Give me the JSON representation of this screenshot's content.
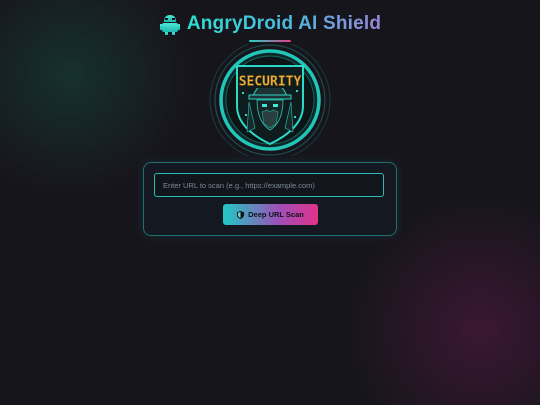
{
  "header": {
    "title": "AngryDroid AI Shield",
    "logo_icon": "droid-icon"
  },
  "badge": {
    "label": "SECURITY",
    "icon": "hooded-hacker-icon"
  },
  "scan": {
    "placeholder": "Enter URL to scan (e.g., https://example.com)",
    "value": "",
    "button_label": "Deep URL Scan",
    "button_icon": "shield-icon"
  },
  "colors": {
    "accent_teal": "#2de0d2",
    "accent_pink": "#e0338a",
    "background": "#17151c",
    "badge_gold": "#f0b23c"
  }
}
